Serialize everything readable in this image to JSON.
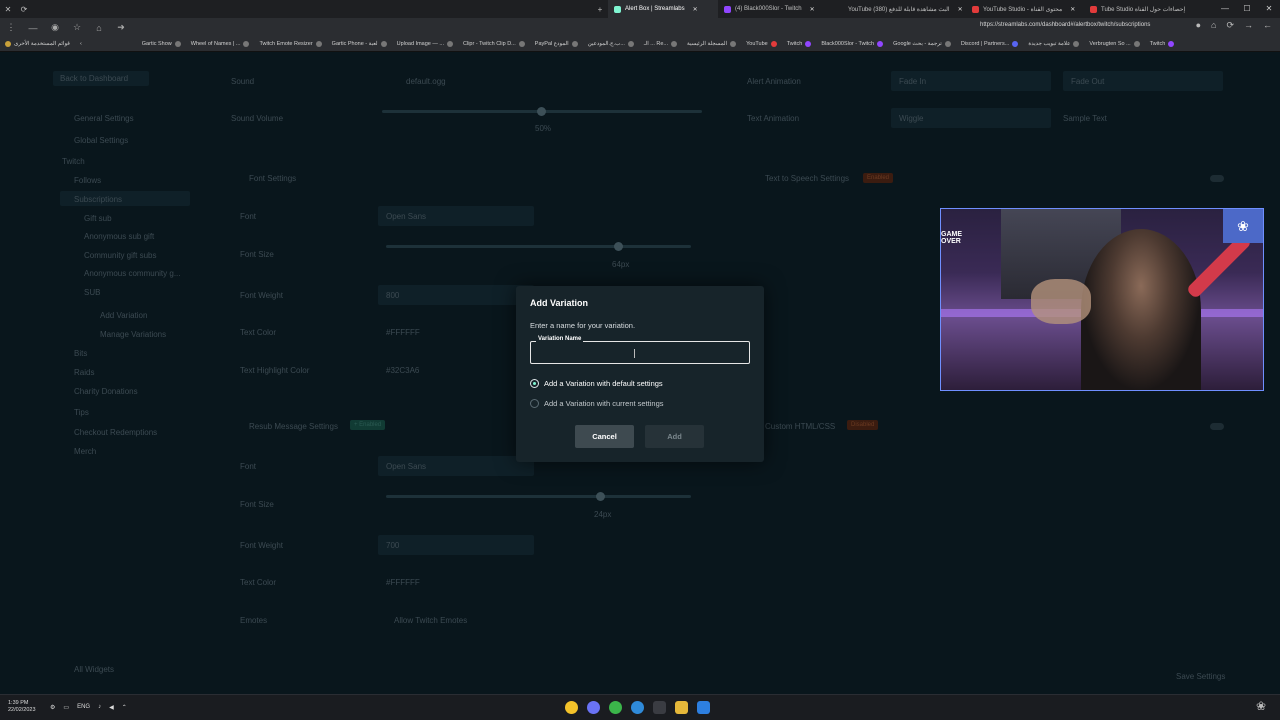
{
  "browser": {
    "tabs": [
      {
        "label": "Alert Box | Streamlabs",
        "active": true
      },
      {
        "label": "(4) Black000Slor - Twitch",
        "active": false
      },
      {
        "label": "YouTube (380) البث مشاهدة قابلة للدفع",
        "active": false
      },
      {
        "label": "YouTube Studio - محتوى القناة",
        "active": false
      },
      {
        "label": "Tube Studio إحصاءات حول القناة",
        "active": false
      }
    ],
    "url": "https://streamlabs.com/dashboard#/alertbox/twitch/subscriptions",
    "bookmarks": [
      "Gartic Show",
      "Wheel of Names | ...",
      "Twitch Emote Resizer",
      "Gartic Phone - لعبة",
      "Upload Image — ...",
      "Clipr - Twitch Clip D...",
      "PayPal المودع",
      "ب.ج.المودعين...",
      "الـ ... Re...",
      "المسجلة الرئيسية",
      "YouTube",
      "Twitch",
      "Black000Slor - Twitch",
      "Google ترجمة - بحث",
      "Discord | Partners...",
      "علامة تبويب جديدة",
      "Verbrugten So ...",
      "Twitch"
    ],
    "bookmarks_left": "قوائم المستخدمة الأخرى"
  },
  "background_page": {
    "sidebar": {
      "back": "Back to Dashboard",
      "items": [
        "General Settings",
        "Global Settings",
        "Twitch",
        "Follows",
        "Subscriptions",
        "Gift sub",
        "Anonymous sub gift",
        "Community gift subs",
        "Anonymous community g...",
        "SUB",
        "Add Variation",
        "Manage Variations",
        "Bits",
        "Raids",
        "Charity Donations",
        "Tips",
        "Checkout Redemptions",
        "Merch"
      ],
      "all_widgets": "All Widgets"
    },
    "main_left": {
      "sound_label": "Sound",
      "sound_value": "default.ogg",
      "sound_volume_label": "Sound Volume",
      "sound_volume_value": "50%",
      "font_settings": "Font Settings",
      "font_label": "Font",
      "font_value": "Open Sans",
      "font_size_label": "Font Size",
      "font_size_value": "64px",
      "font_weight_label": "Font Weight",
      "font_weight_value": "800",
      "text_color_label": "Text Color",
      "text_color_value": "#FFFFFF",
      "text_highlight_label": "Text Highlight Color",
      "text_highlight_value": "#32C3A6",
      "resub_settings": "Resub Message Settings",
      "resub_badge": "+ Enabled",
      "font2_label": "Font",
      "font2_value": "Open Sans",
      "font2_size_label": "Font Size",
      "font2_size_value": "24px",
      "font2_weight_label": "Font Weight",
      "font2_weight_value": "700",
      "text2_color_label": "Text Color",
      "text2_color_value": "#FFFFFF",
      "emotes_label": "Emotes",
      "emotes_value": "Allow Twitch Emotes"
    },
    "main_right": {
      "alert_animation_label": "Alert Animation",
      "anim_in": "Fade In",
      "anim_out": "Fade Out",
      "text_animation_label": "Text Animation",
      "text_anim_value": "Wiggle",
      "sample_text": "Sample Text",
      "tts_label": "Text to Speech Settings",
      "tts_badge": "Enabled",
      "custom_html_label": "Custom HTML/CSS",
      "custom_html_badge": "Disabled",
      "save_button": "Save Settings"
    }
  },
  "modal": {
    "title": "Add Variation",
    "description": "Enter a name for your variation.",
    "field_label": "Variation Name",
    "field_value": "",
    "radio_default": "Add a Variation with default settings",
    "radio_current": "Add a Variation with current settings",
    "selected_option": "default",
    "cancel": "Cancel",
    "add": "Add"
  },
  "webcam": {
    "overlay_logo": "GAME OVER"
  },
  "taskbar": {
    "time": "1:39 PM",
    "date": "22/02/2023",
    "lang": "ENG"
  },
  "colors": {
    "accent": "#80f5d2",
    "modal_bg": "#17242a",
    "page_bg": "#09161c"
  }
}
